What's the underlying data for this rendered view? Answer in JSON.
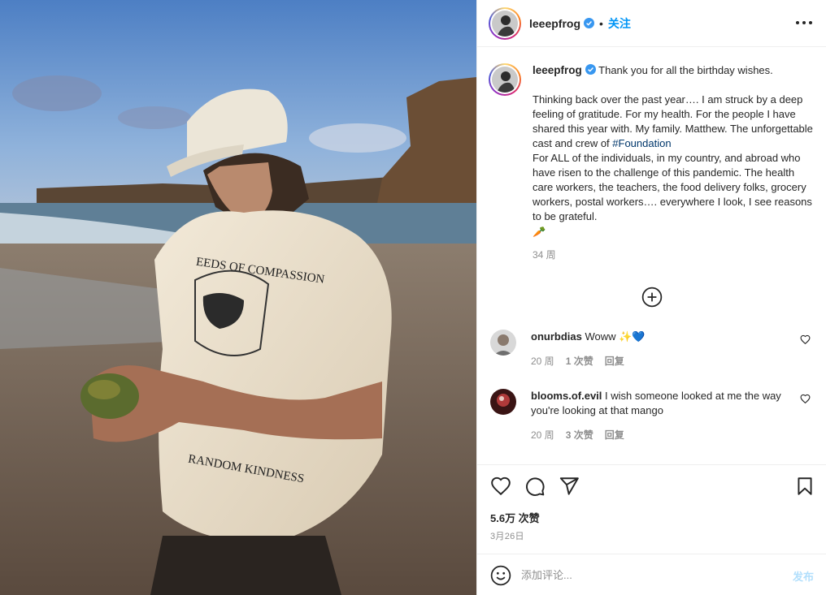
{
  "post": {
    "username": "leeepfrog",
    "follow_label": "关注",
    "dot": "•",
    "icons": {
      "verified": "verified-badge-icon",
      "more": "more-options-icon",
      "load_more": "plus-circle-icon",
      "like": "heart-icon",
      "comment": "comment-icon",
      "share": "paper-plane-icon",
      "save": "bookmark-icon",
      "emoji": "smiley-icon"
    },
    "colors": {
      "accent": "#0095f6",
      "verified": "#3897f0",
      "muted": "#8e8e8e",
      "text": "#262626"
    }
  },
  "caption": {
    "username": "leeepfrog",
    "first_line": "Thank you for all the birthday wishes.",
    "para_before_tag": "Thinking back over the past year…. I am struck by a deep feeling of gratitude. For my health. For the people I have shared this year with. My family. Matthew. The unforgettable cast and crew of ",
    "hashtag": "#Foundation",
    "para_after_tag": "For ALL of the individuals, in my country, and abroad who have risen to the challenge of this pandemic. The health care workers, the teachers, the food delivery folks, grocery workers, postal workers…. everywhere I look, I see reasons to be grateful.",
    "emoji": "🥕",
    "time": "34 周"
  },
  "comments": [
    {
      "username": "onurbdias",
      "text": "Woww ✨💙",
      "time": "20 周",
      "likes": "1 次赞",
      "reply": "回复"
    },
    {
      "username": "blooms.of.evil",
      "text": "I wish someone looked at me the way you're looking at that mango",
      "time": "20 周",
      "likes": "3 次赞",
      "reply": "回复"
    }
  ],
  "stats": {
    "likes": "5.6万 次赞",
    "date": "3月26日"
  },
  "add_comment": {
    "placeholder": "添加评论...",
    "post_label": "发布"
  }
}
